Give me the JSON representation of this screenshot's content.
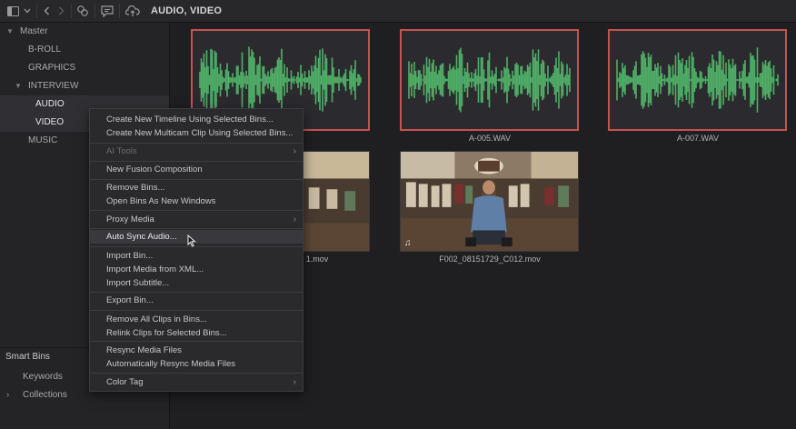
{
  "breadcrumb": "AUDIO, VIDEO",
  "bins": {
    "master": "Master",
    "items": [
      "B-ROLL",
      "GRAPHICS",
      "INTERVIEW",
      "AUDIO",
      "VIDEO",
      "MUSIC"
    ]
  },
  "smart_bins": {
    "title": "Smart Bins",
    "items": [
      "Keywords",
      "Collections"
    ]
  },
  "clips": [
    {
      "label": "",
      "type": "audio"
    },
    {
      "label": "A-005.WAV",
      "type": "audio"
    },
    {
      "label": "A-007.WAV",
      "type": "audio"
    },
    {
      "label": "1.mov",
      "type": "video"
    },
    {
      "label": "F002_08151729_C012.mov",
      "type": "video"
    }
  ],
  "context_menu": {
    "items": [
      "Create New Timeline Using Selected Bins...",
      "Create New Multicam Clip Using Selected Bins...",
      "AI Tools",
      "New Fusion Composition",
      "Remove Bins...",
      "Open Bins As New Windows",
      "Proxy Media",
      "Auto Sync Audio...",
      "Import Bin...",
      "Import Media from XML...",
      "Import Subtitle...",
      "Export Bin...",
      "Remove All Clips in Bins...",
      "Relink Clips for Selected Bins...",
      "Resync Media Files",
      "Automatically Resync Media Files",
      "Color Tag"
    ]
  },
  "colors": {
    "waveform": "#4fae67",
    "selection_border": "#c9514f",
    "background": "#1f1f22"
  }
}
